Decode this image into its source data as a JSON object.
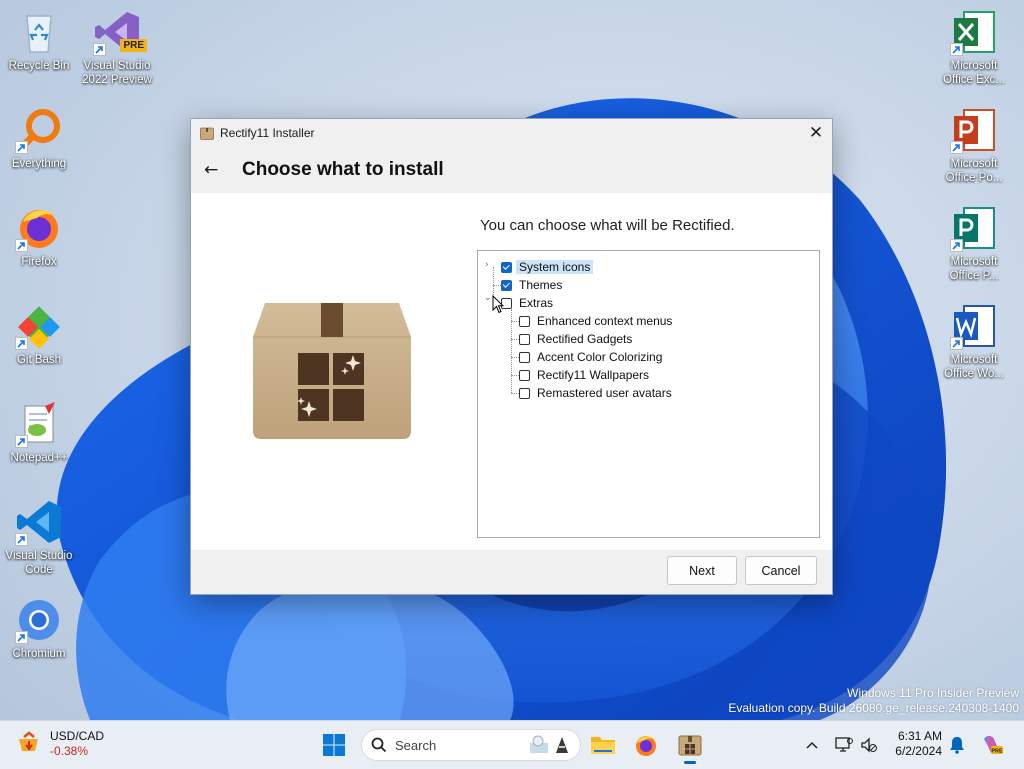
{
  "desktop": {
    "icons_left": [
      {
        "label": "Recycle Bin"
      },
      {
        "label": "Visual Studio 2022 Preview",
        "badge": "PRE"
      },
      {
        "label": "Everything"
      },
      {
        "label": "Firefox"
      },
      {
        "label": "Git Bash"
      },
      {
        "label": "Notepad++"
      },
      {
        "label": "Visual Studio Code"
      },
      {
        "label": "Chromium"
      }
    ],
    "icons_right": [
      {
        "label": "Microsoft Office Exc..."
      },
      {
        "label": "Microsoft Office Po..."
      },
      {
        "label": "Microsoft Office P..."
      },
      {
        "label": "Microsoft Office Wo..."
      }
    ],
    "watermark": {
      "line1": "Windows 11 Pro Insider Preview",
      "line2": "Evaluation copy. Build 26080.ge_release.240308-1400"
    }
  },
  "window": {
    "title": "Rectify11 Installer",
    "close_glyph": "✕",
    "back_glyph": "←",
    "heading": "Choose what to install",
    "subtitle": "You can choose what will be Rectified.",
    "tree": [
      {
        "label": "System icons",
        "checked": true,
        "selected": true,
        "level": 0,
        "expander": "›"
      },
      {
        "label": "Themes",
        "checked": true,
        "level": 0
      },
      {
        "label": "Extras",
        "checked": false,
        "level": 0,
        "expander": "⌄"
      },
      {
        "label": "Enhanced context menus",
        "checked": false,
        "level": 1
      },
      {
        "label": "Rectified Gadgets",
        "checked": false,
        "level": 1
      },
      {
        "label": "Accent Color Colorizing",
        "checked": false,
        "level": 1
      },
      {
        "label": "Rectify11 Wallpapers",
        "checked": false,
        "level": 1
      },
      {
        "label": "Remastered user avatars",
        "checked": false,
        "level": 1
      }
    ],
    "buttons": {
      "next": "Next",
      "cancel": "Cancel"
    }
  },
  "taskbar": {
    "widget": {
      "title": "USD/CAD",
      "value": "-0.38%",
      "value_color": "#c42b1c"
    },
    "search_placeholder": "Search",
    "clock": {
      "time": "6:31 AM",
      "date": "6/2/2024"
    },
    "tray_chevron": "^",
    "accent": "#0067c0"
  }
}
